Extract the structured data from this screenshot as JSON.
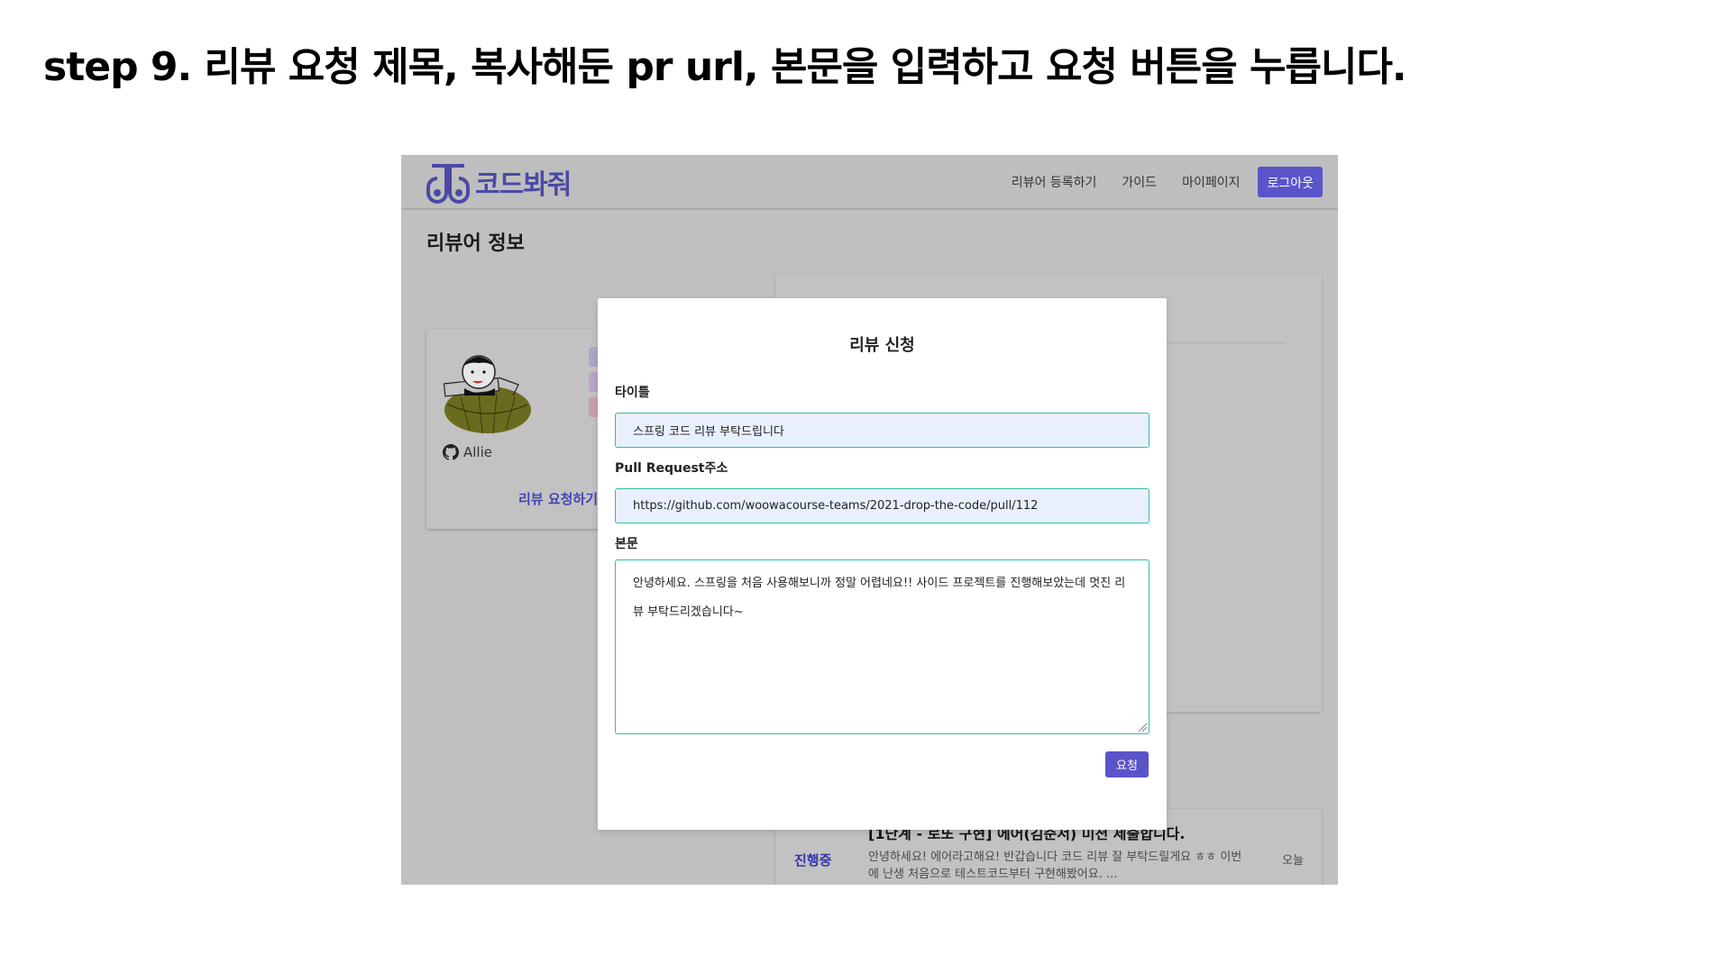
{
  "slide": {
    "title": "step 9. 리뷰 요청 제목, 복사해둔 pr url, 본문을 입력하고 요청 버튼을 누릅니다."
  },
  "header": {
    "logo_text": "코드봐줘",
    "nav": {
      "register_reviewer": "리뷰어 등록하기",
      "guide": "가이드",
      "mypage": "마이페이지",
      "logout": "로그아웃"
    }
  },
  "page": {
    "heading": "리뷰어 정보",
    "profile": {
      "github_name": "Allie",
      "request_link": "리뷰 요청하기"
    },
    "review_item": {
      "status": "진행중",
      "title": "[1단계 - 로또 구현] 에어(김준서) 미션 제출합니다.",
      "body": "안녕하세요! 에어라고해요! 반갑습니다 코드 리뷰 잘 부탁드릴게요 ㅎㅎ 이번에 난생 처음으로 테스트코드부터 구현해봤어요. ...",
      "date": "오늘"
    }
  },
  "modal": {
    "title": "리뷰 신청",
    "title_label": "타이틀",
    "title_value": "스프링 코드 리뷰 부탁드립니다",
    "pr_label": "Pull Request주소",
    "pr_value": "https://github.com/woowacourse-teams/2021-drop-the-code/pull/112",
    "body_label": "본문",
    "body_value": "안녕하세요. 스프링을 처음 사용해보니까 정말 어렵네요!! 사이드 프로젝트를 진행해보았는데 멋진 리뷰 부탁드리겠습니다~",
    "submit_label": "요청"
  },
  "colors": {
    "accent": "#5b54c9",
    "input_border": "#2fbf9f",
    "input_fill": "#e8f0fe",
    "overlay": "#c0c0c0"
  }
}
